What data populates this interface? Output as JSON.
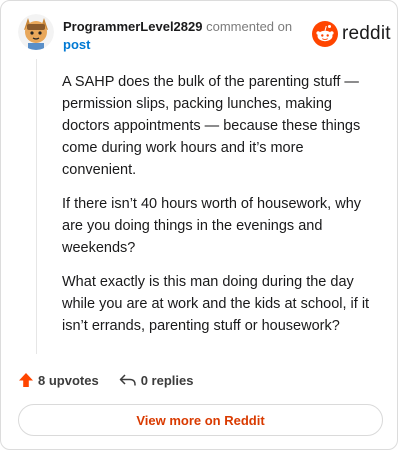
{
  "header": {
    "username": "ProgrammerLevel2829",
    "action": "commented on",
    "post_link": "post",
    "brand": "reddit"
  },
  "comment": {
    "paragraphs": [
      "A SAHP does the bulk of the parenting stuff — permission slips, packing lunches, making doctors appointments — because these things come during work hours and it’s more convenient.",
      "If there isn’t 40 hours worth of housework, why are you doing things in the evenings and weekends?",
      "What exactly is this man doing during the day while you are at work and the kids at school, if it isn’t errands, parenting stuff or housework?"
    ]
  },
  "footer": {
    "upvotes": "8 upvotes",
    "replies": "0 replies",
    "view_more": "View more on Reddit"
  },
  "icons": {
    "avatar": "avatar-icon",
    "brand": "reddit-logo-icon",
    "upvote": "upvote-arrow-icon",
    "reply": "reply-arrow-icon"
  },
  "colors": {
    "brand_orange": "#ff4500",
    "link_blue": "#0079d3",
    "view_more_text": "#d93a00"
  }
}
